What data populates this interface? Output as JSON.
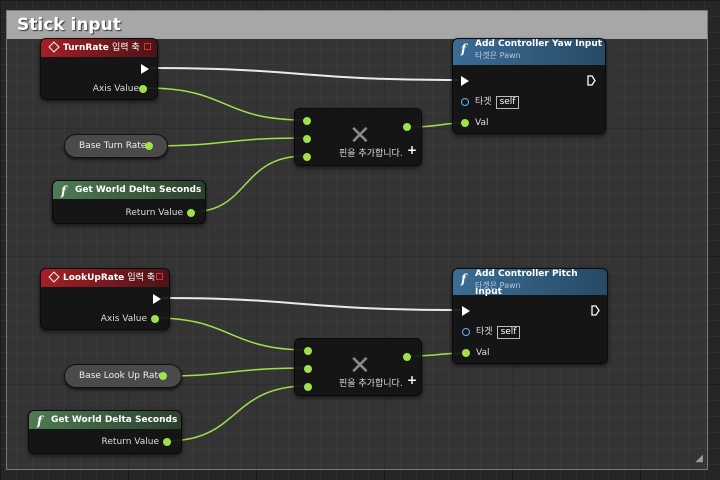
{
  "comment": {
    "title": "Stick input"
  },
  "section1": {
    "event": {
      "name": "TurnRate",
      "suffix": "입력 축",
      "axis_value_label": "Axis Value"
    },
    "variable": {
      "label": "Base Turn Rate"
    },
    "delta": {
      "title": "Get World Delta Seconds",
      "return_label": "Return Value"
    },
    "multiply": {
      "add_pin_label": "핀을 추가합니다.",
      "plus": "+"
    },
    "add_input": {
      "title": "Add Controller Yaw Input",
      "subtitle": "타겟은 Pawn",
      "target_label": "타겟",
      "self_label": "self",
      "val_label": "Val"
    }
  },
  "section2": {
    "event": {
      "name": "LookUpRate",
      "suffix": "입력 축",
      "axis_value_label": "Axis Value"
    },
    "variable": {
      "label": "Base Look Up Rate"
    },
    "delta": {
      "title": "Get World Delta Seconds",
      "return_label": "Return Value"
    },
    "multiply": {
      "add_pin_label": "핀을 추가합니다.",
      "plus": "+"
    },
    "add_input": {
      "title": "Add Controller Pitch Input",
      "subtitle": "타겟은 Pawn",
      "target_label": "타겟",
      "self_label": "self",
      "val_label": "Val"
    }
  },
  "colors": {
    "float_pin": "#9fe04c",
    "object_pin": "#5cb8ff",
    "exec_pin": "#ffffff",
    "event_header": "#a51f25",
    "function_header": "#3a6d95",
    "pure_function_header": "#4e7b53"
  },
  "icons": {
    "event": "diamond-icon",
    "function": "function-f-icon",
    "multiply": "multiply-x-icon"
  }
}
